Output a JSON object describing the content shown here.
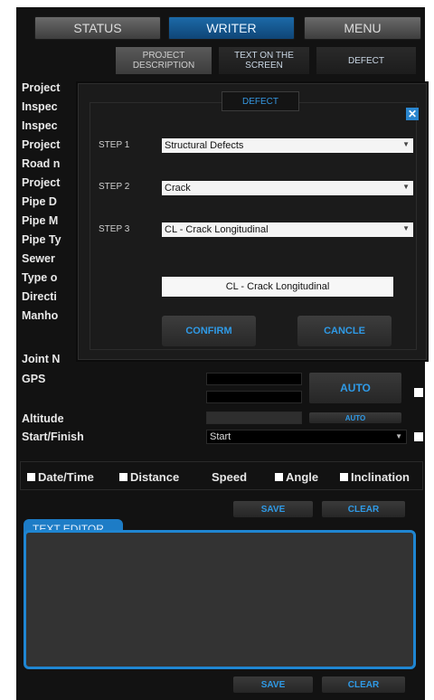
{
  "tabs": {
    "status": "STATUS",
    "writer": "WRITER",
    "menu": "MENU"
  },
  "subtabs": {
    "project": "PROJECT DESCRIPTION",
    "text": "TEXT ON THE SCREEN",
    "defect": "DEFECT"
  },
  "labels": [
    "Project",
    "Inspec",
    "Inspec",
    "Project",
    "Road n",
    "Project",
    "Pipe D",
    "Pipe M",
    "Pipe Ty",
    "Sewer",
    "Type o",
    "Directi",
    "Manho"
  ],
  "joint_label": "Joint N",
  "gps_label": "GPS",
  "auto_label": "AUTO",
  "altitude_label": "Altitude",
  "altitude_auto": "AUTO",
  "start_finish_label": "Start/Finish",
  "start_value": "Start",
  "checkboxes": {
    "datetime": "Date/Time",
    "distance": "Distance",
    "speed": "Speed",
    "angle": "Angle",
    "inclination": "Inclination"
  },
  "save_label": "SAVE",
  "clear_label": "CLEAR",
  "editor_label": "TEXT EDITOR",
  "dialog": {
    "title": "DEFECT",
    "close": "✕",
    "step1_label": "STEP 1",
    "step1_value": "Structural Defects",
    "step2_label": "STEP 2",
    "step2_value": "Crack",
    "step3_label": "STEP 3",
    "step3_value": "CL - Crack Longitudinal",
    "result": "CL - Crack Longitudinal",
    "confirm": "CONFIRM",
    "cancel": "CANCLE"
  },
  "colors": {
    "accent": "#1d7cc6",
    "background": "#121212",
    "button_text": "#2f9ae6"
  }
}
